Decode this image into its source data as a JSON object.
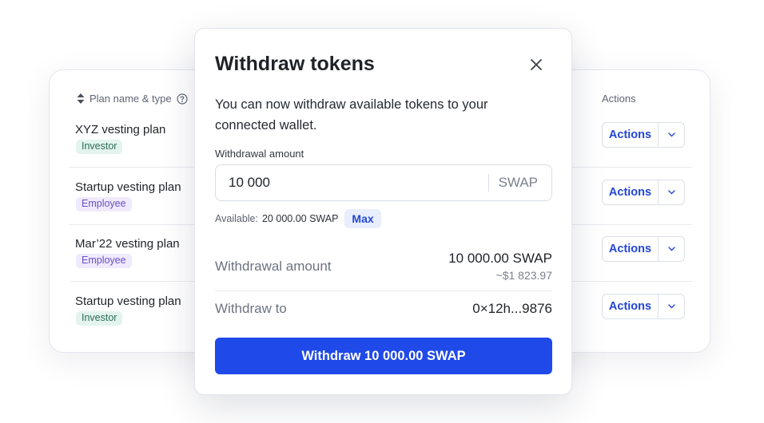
{
  "table": {
    "col_plan_label": "Plan name & type",
    "col_actions_label": "Actions",
    "rows": [
      {
        "name": "XYZ vesting plan",
        "type": "Investor",
        "action_label": "Actions"
      },
      {
        "name": "Startup vesting plan",
        "type": "Employee",
        "action_label": "Actions"
      },
      {
        "name": "Mar’22 vesting plan",
        "type": "Employee",
        "action_label": "Actions"
      },
      {
        "name": "Startup vesting plan",
        "type": "Investor",
        "action_label": "Actions"
      }
    ]
  },
  "modal": {
    "title": "Withdraw tokens",
    "description": "You can now withdraw available tokens to your connected wallet.",
    "amount_label": "Withdrawal amount",
    "amount_value": "10 000",
    "amount_unit": "SWAP",
    "available_label": "Available:",
    "available_value": "20 000.00 SWAP",
    "max_label": "Max",
    "summary": {
      "amount_label": "Withdrawal amount",
      "amount_value": "10 000.00 SWAP",
      "amount_usd": "~$1 823.97",
      "to_label": "Withdraw to",
      "to_value": "0×12h...9876"
    },
    "submit_label": "Withdraw 10 000.00 SWAP"
  },
  "colors": {
    "accent": "#1f49e8",
    "link": "#2346d6",
    "investor_badge_bg": "#e3f4ee",
    "employee_badge_bg": "#efeafd"
  },
  "icons": [
    "sort-icon",
    "help-icon",
    "chevron-down-icon",
    "close-icon"
  ]
}
